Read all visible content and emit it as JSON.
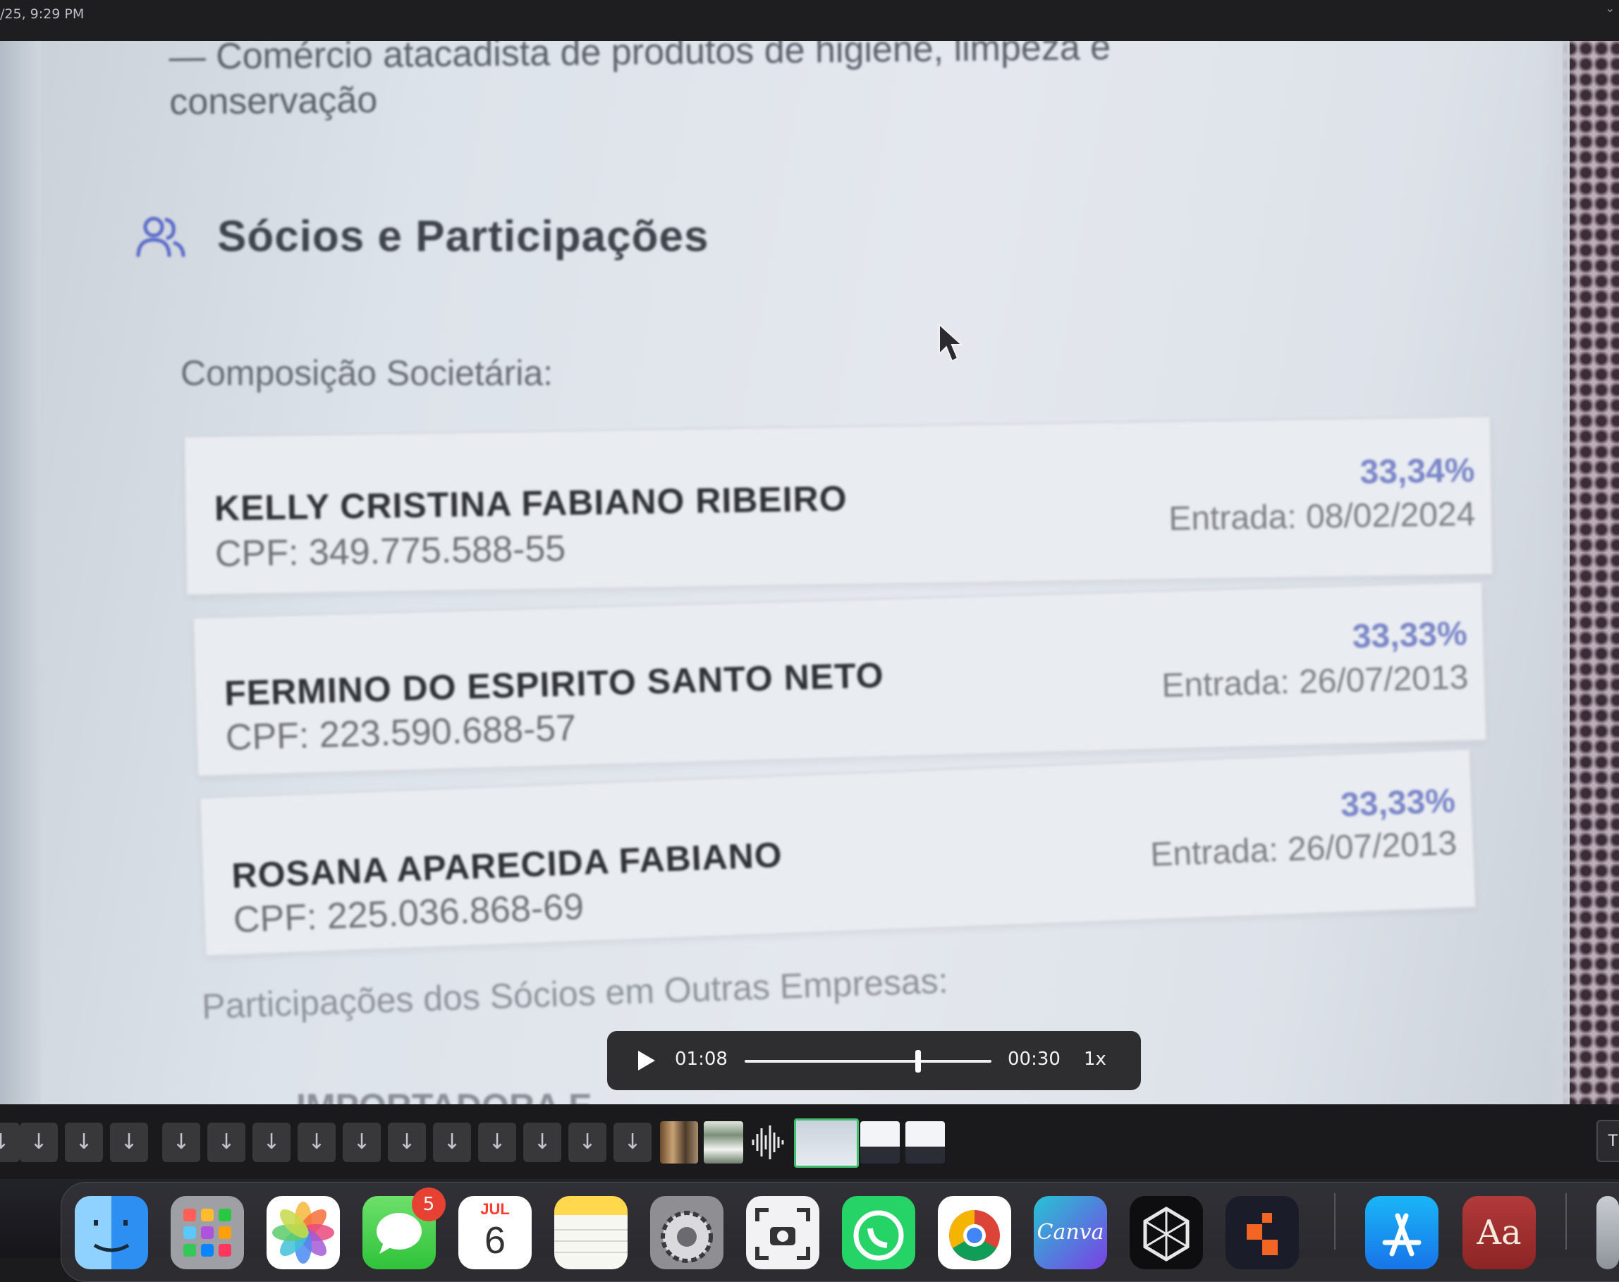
{
  "topbar": {
    "time": "/25, 9:29 PM"
  },
  "document": {
    "intro_line1": "— Comércio atacadista de produtos de higiene, limpeza e",
    "intro_line2": "conservação",
    "section_title": "Sócios e Participações",
    "subtitle": "Composição Societária:",
    "partners": [
      {
        "name": "KELLY CRISTINA FABIANO RIBEIRO",
        "cpf": "CPF: 349.775.588-55",
        "percent": "33,34%",
        "entry": "Entrada: 08/02/2024"
      },
      {
        "name": "FERMINO DO ESPIRITO SANTO NETO",
        "cpf": "CPF: 223.590.688-57",
        "percent": "33,33%",
        "entry": "Entrada: 26/07/2013"
      },
      {
        "name": "ROSANA APARECIDA FABIANO",
        "cpf": "CPF: 225.036.868-69",
        "percent": "33,33%",
        "entry": "Entrada: 26/07/2013"
      }
    ],
    "other_companies": "Participações dos Sócios em Outras Empresas:",
    "cutoff_text": "IMPORTADORA E"
  },
  "player": {
    "current_time": "01:08",
    "remaining_time": "00:30",
    "speed": "1x",
    "progress": 0.69
  },
  "filmstrip": {
    "download_glyph": "↓",
    "right_label": "T"
  },
  "dock": {
    "apps": [
      "Finder",
      "Launchpad",
      "Photos",
      "Messages",
      "Calendar",
      "Notes",
      "System Settings",
      "Screenshot",
      "WhatsApp",
      "Google Chrome",
      "Canva",
      "Perplexity",
      "Toolbox",
      "App Store",
      "Dictionary"
    ],
    "messages_badge": "5",
    "calendar_month": "JUL",
    "calendar_day": "6",
    "canva_label": "Canva",
    "dictionary_label": "Aa"
  },
  "colors": {
    "accent_percent": "#7a86c8",
    "badge": "#e74133"
  }
}
